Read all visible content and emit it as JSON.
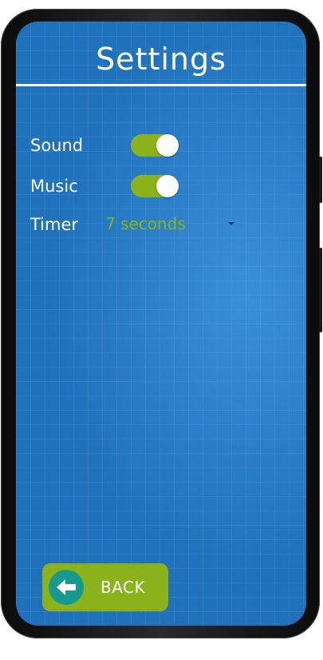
{
  "header": {
    "title": "Settings"
  },
  "settings": {
    "sound": {
      "label": "Sound",
      "enabled": true
    },
    "music": {
      "label": "Music",
      "enabled": true
    },
    "timer": {
      "label": "Timer",
      "value": "7 seconds"
    }
  },
  "footer": {
    "back_label": "BACK",
    "back_icon": "arrow-left-icon"
  },
  "colors": {
    "background": "#1f71bb",
    "accent": "#8bb21a",
    "back_icon_circle": "#169a8e",
    "text": "#ffffff"
  }
}
